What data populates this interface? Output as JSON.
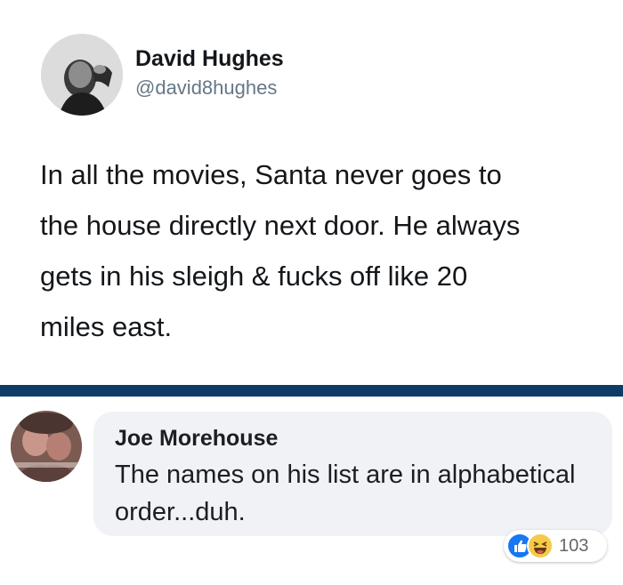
{
  "tweet": {
    "author_name": "David Hughes",
    "author_handle": "@david8hughes",
    "text": "In all the movies, Santa never goes to\nthe house directly next door. He always\ngets in his sleigh & fucks off like 20\nmiles east."
  },
  "comment": {
    "author_name": "Joe Morehouse",
    "text": "The names on his list are in alphabetical order...duh.",
    "reactions": {
      "icons": [
        "like-icon",
        "haha-icon"
      ],
      "count": "103"
    }
  },
  "colors": {
    "divider": "#0f3b67",
    "bubble": "#f0f2f5",
    "like": "#1877f2",
    "haha": "#f7c948",
    "handle": "#657786"
  }
}
